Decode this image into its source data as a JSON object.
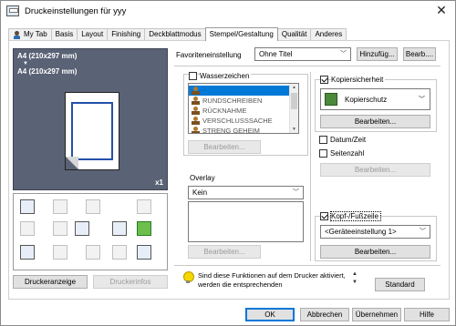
{
  "window": {
    "title": "Druckeinstellungen für yyy",
    "close_glyph": "✕"
  },
  "tabs": [
    "My Tab",
    "Basis",
    "Layout",
    "Finishing",
    "Deckblattmodus",
    "Stempel/Gestaltung",
    "Qualität",
    "Anderes"
  ],
  "active_tab": "Stempel/Gestaltung",
  "favorites": {
    "label": "Favoriteneinstellung",
    "value": "Ohne Titel",
    "add_button": "Hinzufüg...",
    "edit_button": "Bearb...."
  },
  "preview": {
    "paper_size_1": "A4 (210x297 mm)",
    "arrow": "▼",
    "paper_size_2": "A4 (210x297 mm)",
    "copies": "x1"
  },
  "left_buttons": {
    "printer_display": "Druckeranzeige",
    "printer_info": "Druckerinfos"
  },
  "watermark": {
    "label": "Wasserzeichen",
    "checked": false,
    "items": [
      "VERTRAULICH",
      "RUNDSCHREIBEN",
      "RÜCKNAHME",
      "VERSCHLUSSSACHE",
      "STRENG GEHEIM"
    ],
    "edit_button": "Bearbeiten..."
  },
  "overlay": {
    "label": "Overlay",
    "value": "Kein",
    "edit_button": "Bearbeiten..."
  },
  "copy_security": {
    "label": "Kopiersicherheit",
    "checked": true,
    "value": "Kopierschutz",
    "edit_button": "Bearbeiten..."
  },
  "date_time": {
    "label": "Datum/Zeit",
    "checked": false
  },
  "page_number": {
    "label": "Seitenzahl",
    "checked": false,
    "edit_button": "Bearbeiten..."
  },
  "header_footer": {
    "label": "Kopf-/Fußzeile",
    "checked": true,
    "value": "<Geräteeinstellung 1>",
    "edit_button": "Bearbeiten..."
  },
  "info_text": "Sind diese Funktionen auf dem Drucker aktiviert, werden die entsprechenden",
  "standard_button": "Standard",
  "footer": {
    "ok": "OK",
    "cancel": "Abbrechen",
    "apply": "Übernehmen",
    "help": "Hilfe"
  },
  "colors": {
    "accent": "#0078d7",
    "preview_bg": "#5a6275",
    "selection_green": "#6bbf4a"
  }
}
